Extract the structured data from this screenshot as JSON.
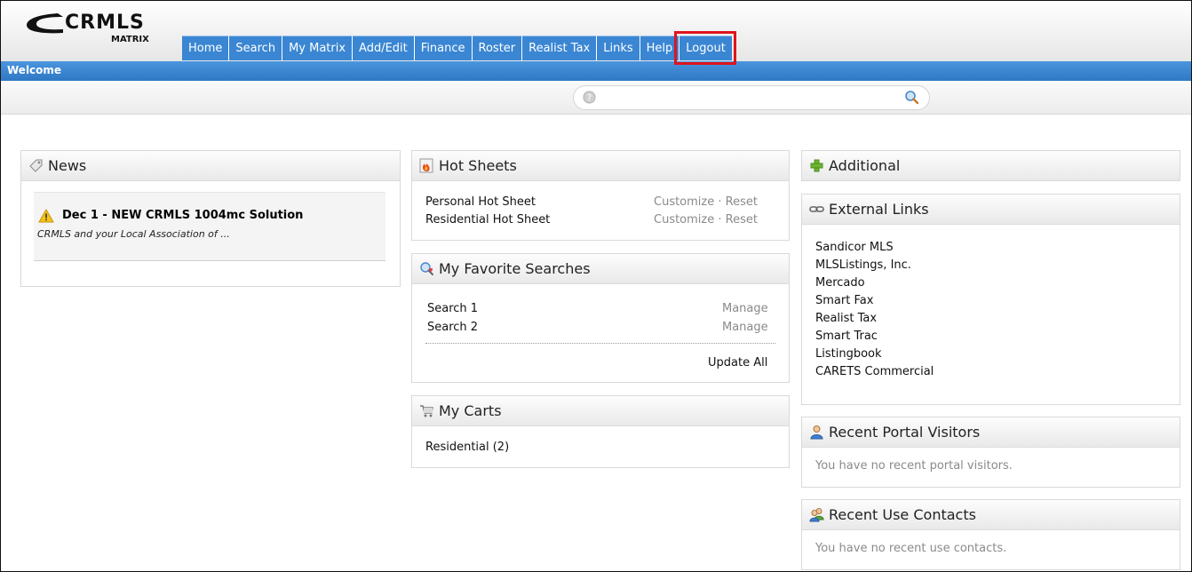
{
  "brand": {
    "line1": "CRMLS",
    "line2": "MATRIX"
  },
  "nav": [
    "Home",
    "Search",
    "My Matrix",
    "Add/Edit",
    "Finance",
    "Roster",
    "Realist Tax",
    "Links",
    "Help",
    "Logout"
  ],
  "welcome": "Welcome",
  "search": {
    "value": "",
    "placeholder": ""
  },
  "news": {
    "title": "News",
    "item_title": "Dec 1 - NEW CRMLS 1004mc Solution",
    "item_sub": "CRMLS and your Local Association of ..."
  },
  "hot_sheets": {
    "title": "Hot Sheets",
    "rows": [
      {
        "name": "Personal Hot Sheet",
        "customize": "Customize",
        "sep": "·",
        "reset": "Reset"
      },
      {
        "name": "Residential Hot Sheet",
        "customize": "Customize",
        "sep": "·",
        "reset": "Reset"
      }
    ]
  },
  "favorites": {
    "title": "My Favorite Searches",
    "rows": [
      {
        "name": "Search 1",
        "action": "Manage"
      },
      {
        "name": "Search 2",
        "action": "Manage"
      }
    ],
    "update_all": "Update All"
  },
  "carts": {
    "title": "My Carts",
    "item": "Residential (2)"
  },
  "additional": {
    "title": "Additional"
  },
  "external": {
    "title": "External Links",
    "links": [
      "Sandicor MLS",
      "MLSListings, Inc.",
      "Mercado",
      "Smart Fax",
      "Realist Tax",
      "Smart Trac",
      "Listingbook",
      "CARETS Commercial"
    ]
  },
  "portal_visitors": {
    "title": "Recent Portal Visitors",
    "empty": "You have no recent portal visitors."
  },
  "use_contacts": {
    "title": "Recent Use Contacts",
    "empty": "You have no recent use contacts."
  },
  "colors": {
    "nav_blue": "#3a86d3",
    "welcome_blue": "#2f78c4",
    "highlight_red": "#e0141d"
  }
}
